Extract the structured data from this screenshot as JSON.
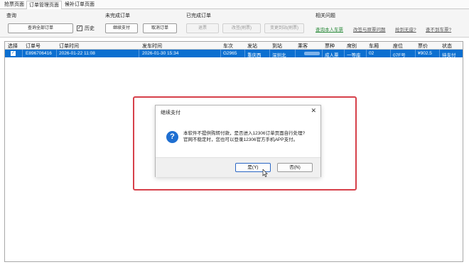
{
  "tabs": [
    {
      "label": "抢票页面"
    },
    {
      "label": "订单管理页面"
    },
    {
      "label": "候补订单页面"
    }
  ],
  "toolbar": {
    "query": {
      "title": "查询",
      "query_all_label": "查询全部订单",
      "history_label": "历史",
      "history_checked": true
    },
    "pending": {
      "title": "未完成订单",
      "continue_pay_label": "继续支付",
      "cancel_order_label": "取消订单"
    },
    "completed": {
      "title": "已完成订单",
      "refund_label": "退票",
      "change_label": "改签(刷票)",
      "change_station_label": "变更到站(刷票)"
    },
    "related": {
      "title": "相关问题",
      "links": [
        {
          "label": "查询本人车票",
          "color": "#2a8a3a"
        },
        {
          "label": "改签与原票问题",
          "color": "#555555"
        },
        {
          "label": "抢到无座?",
          "color": "#555555"
        },
        {
          "label": "查不到车票?",
          "color": "#555555"
        }
      ]
    }
  },
  "table": {
    "columns": [
      "选择",
      "订单号",
      "订单时间",
      "发车时间",
      "车次",
      "发站",
      "到站",
      "乘客",
      "票种",
      "席别",
      "车厢",
      "座位",
      "票价",
      "状态"
    ],
    "rows": [
      {
        "selected": true,
        "order_no": "E896706416",
        "order_time": "2026-01-22 11:08",
        "depart_time": "2026-01-30 15:34",
        "train": "G2965",
        "from": "重庆西",
        "to": "深圳北",
        "passenger": "",
        "ticket_type": "成人票",
        "seat_class": "一等座",
        "car": "02",
        "seat": "07F号",
        "price": "¥902.5",
        "status": "待支付"
      }
    ]
  },
  "dialog": {
    "title": "继续支付",
    "close_glyph": "✕",
    "icon": "question-icon",
    "message_line1": "本软件不提供购转付款，是否进入12306订单页面自行处理?",
    "message_line2": "官网不稳定时，您也可以登录12306官方手机APP支付。",
    "yes_label": "是(Y)",
    "no_label": "否(N)"
  },
  "colors": {
    "selection": "#0b6fd0",
    "highlight_box": "#d6404a",
    "question_icon": "#1f6fd1"
  }
}
